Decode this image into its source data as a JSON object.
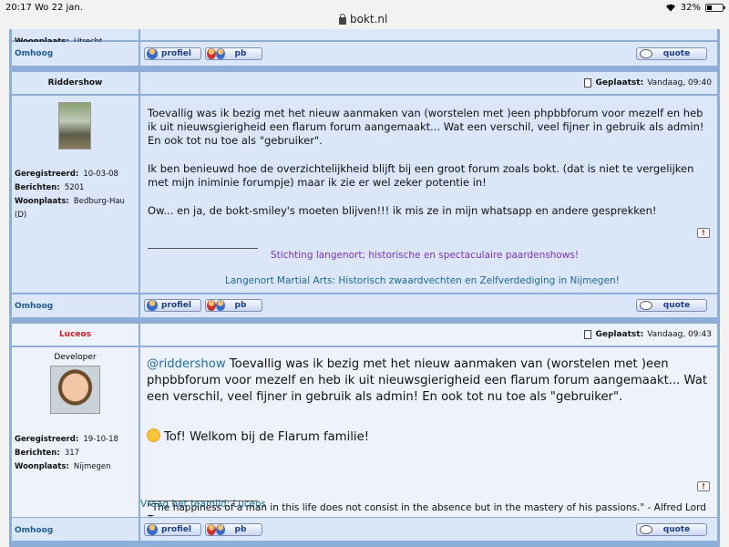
{
  "status_bar": {
    "time": "20:17",
    "date": "Wo 22 jan.",
    "battery": "32%",
    "battery_level": 0.32,
    "url": "bokt.nl"
  },
  "colors": {
    "row_bg": "#dbe6f8",
    "border": "#8eaed8",
    "link": "#1f5e8e",
    "sig_purple": "#7a32b8",
    "sig_teal": "#1f6a8e"
  },
  "top_partial": {
    "woonplaats_label": "Woonplaats:",
    "woonplaats": "Utrecht"
  },
  "buttons": {
    "profiel": "profiel",
    "pb": "pb",
    "quote": "quote",
    "omhoog": "Omhoog",
    "report": "!"
  },
  "posts": [
    {
      "username": "Riddershow",
      "posted_label": "Geplaatst:",
      "posted": "Vandaag, 09:40",
      "registered_label": "Geregistreerd:",
      "registered": "10-03-08",
      "posts_label": "Berichten:",
      "post_count": "5201",
      "location_label": "Woonplaats:",
      "location": "Bedburg-Hau (D)",
      "paragraphs": [
        "Toevallig was ik bezig met het nieuw aanmaken van (worstelen met )een phpbbforum voor mezelf en heb ik uit nieuwsgierigheid een flarum forum aangemaakt... Wat een verschil, veel fijner in gebruik als admin! En ook tot nu toe als \"gebruiker\".",
        "Ik ben benieuwd hoe de overzichtelijkheid blijft bij een groot forum zoals bokt. (dat is niet te vergelijken met mijn iniminie forumpje) maar ik zie er wel zeker potentie in!",
        "Ow... en ja, de bokt-smiley's moeten blijven!!! ik mis ze in mijn whatsapp en andere gesprekken!"
      ],
      "signature": [
        "Stichting langenort; historische en spectaculaire paardenshows!",
        "Langenort Martial Arts: Historisch zwaardvechten en Zelfverdediging in Nijmegen!"
      ]
    },
    {
      "username": "Luceos",
      "rank": "Developer",
      "posted_label": "Geplaatst:",
      "posted": "Vandaag, 09:43",
      "registered_label": "Geregistreerd:",
      "registered": "19-10-18",
      "posts_label": "Berichten:",
      "post_count": "317",
      "location_label": "Woonplaats:",
      "location": "Nijmegen",
      "mention": "@riddershow",
      "quote_text": " Toevallig was ik bezig met het nieuw aanmaken van (worstelen met )een phpbbforum voor mezelf en heb ik uit nieuwsgierigheid een flarum forum aangemaakt... Wat een verschil, veel fijner in gebruik als admin! En ook tot nu toe als \"gebruiker\".",
      "reply": "Tof! Welkom bij de Flarum familie!",
      "signature_quote": "\"The happiness of a man in this life does not consist in the absence but in the mastery of his passions.\" - Alfred Lord Tennyson",
      "signature_link": "Vraag het teamlid: Luceos"
    }
  ]
}
